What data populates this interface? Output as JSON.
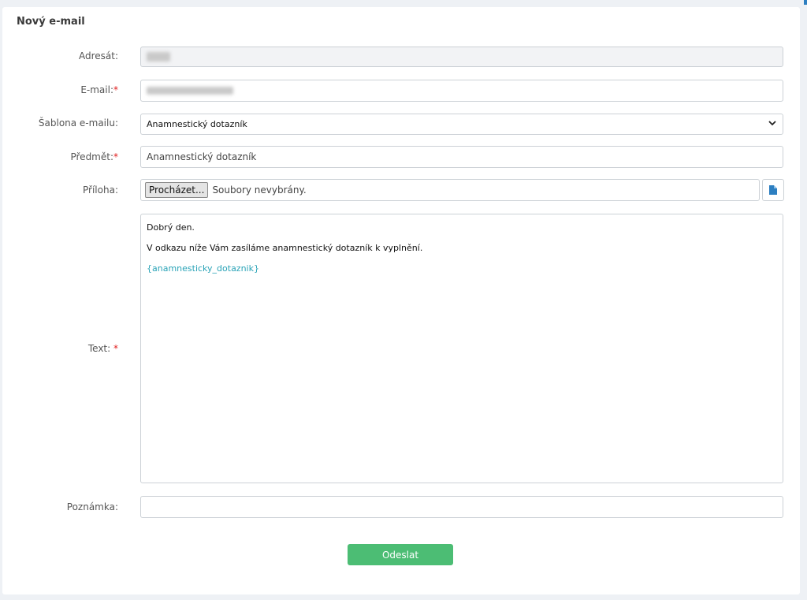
{
  "form": {
    "title": "Nový e-mail",
    "labels": {
      "recipient": "Adresát:",
      "email": "E-mail:",
      "template": "Šablona e-mailu:",
      "subject": "Předmět:",
      "attachment": "Příloha:",
      "text": "Text:",
      "note": "Poznámka:"
    },
    "required_mark": "*",
    "template_value": "Anamnestický dotazník",
    "subject_value": "Anamnestický dotazník",
    "browse_label": "Procházet...",
    "file_status": "Soubory nevybrány.",
    "body_lines": [
      "Dobrý den.",
      "V odkazu níže Vám zasíláme anamnestický dotazník k vyplnění.",
      "{anamnesticky_dotaznik}"
    ],
    "note_value": "",
    "submit_label": "Odeslat"
  },
  "colors": {
    "accent": "#4cbd74",
    "required": "#e02020",
    "link": "#2aa3b7",
    "file_icon": "#2d7fc1"
  },
  "icons": {
    "select_arrow": "chevron-down-icon",
    "file_button": "file-icon"
  }
}
